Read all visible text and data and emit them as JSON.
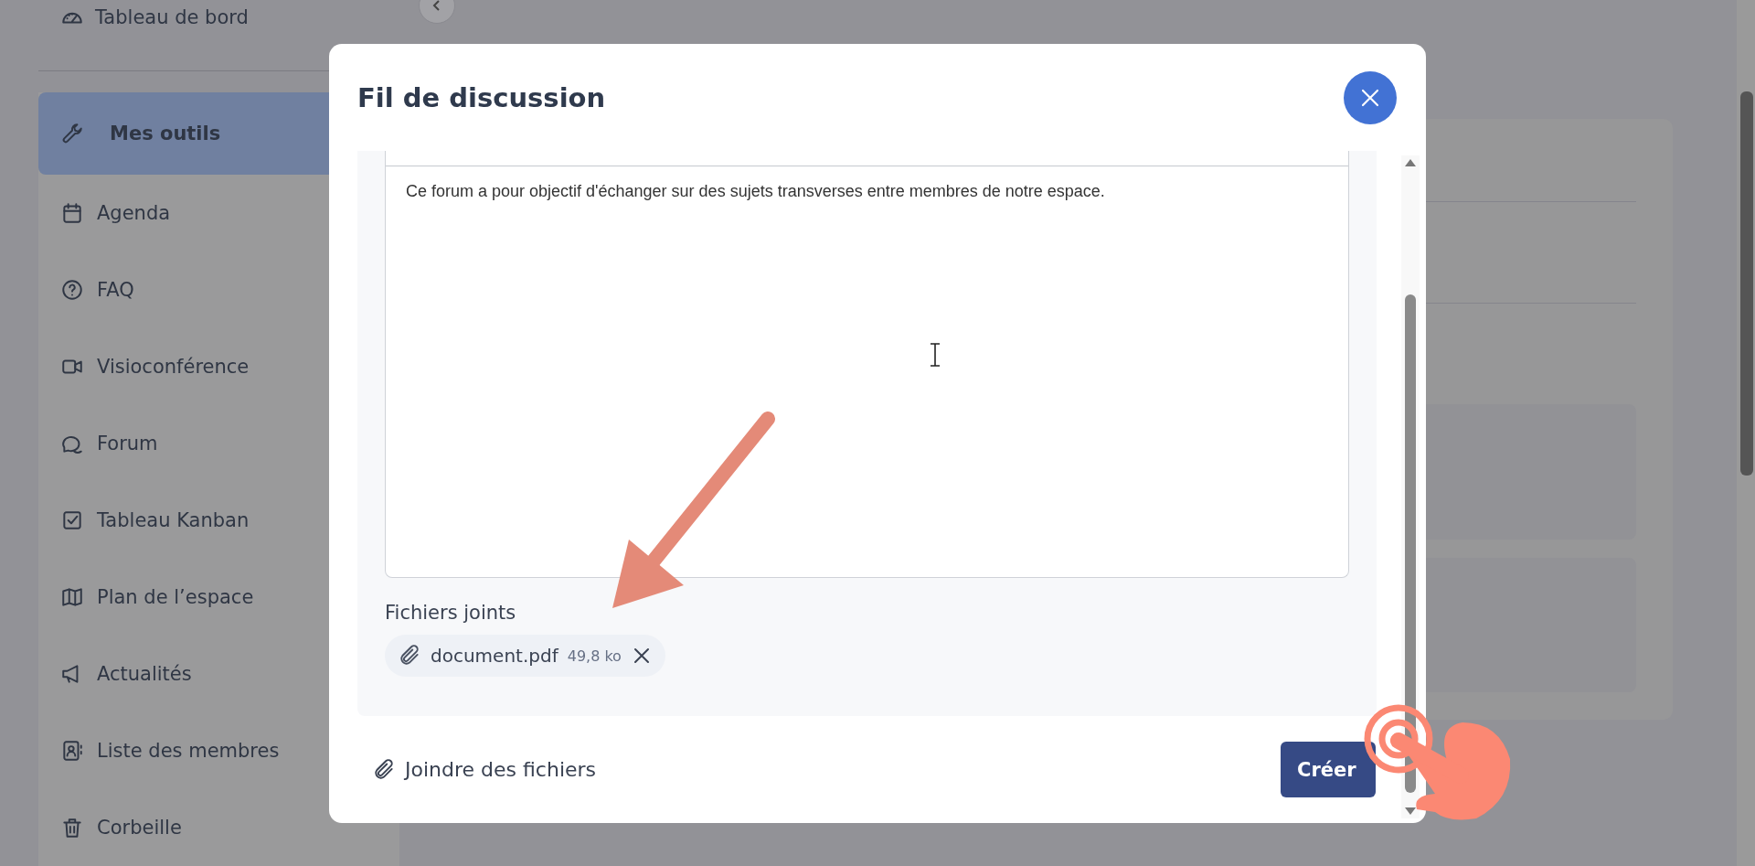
{
  "sidebar": {
    "top_item": {
      "label": "Tableau de bord"
    },
    "items": [
      {
        "label": "Mes outils",
        "selected": true
      },
      {
        "label": "Agenda",
        "selected": false
      },
      {
        "label": "FAQ",
        "selected": false
      },
      {
        "label": "Visioconférence",
        "selected": false
      },
      {
        "label": "Forum",
        "selected": false
      },
      {
        "label": "Tableau Kanban",
        "selected": false
      },
      {
        "label": "Plan de l’espace",
        "selected": false
      },
      {
        "label": "Actualités",
        "selected": false
      },
      {
        "label": "Liste des membres",
        "selected": false
      },
      {
        "label": "Corbeille",
        "selected": false
      }
    ]
  },
  "modal": {
    "title": "Fil de discussion",
    "body_text": "Ce forum a pour objectif d'échanger sur des sujets transverses entre membres de notre espace.",
    "attachments_label": "Fichiers joints",
    "attachments": [
      {
        "name": "document.pdf",
        "size": "49,8 ko"
      }
    ],
    "attach_button": "Joindre des fichiers",
    "submit_button": "Créer"
  }
}
